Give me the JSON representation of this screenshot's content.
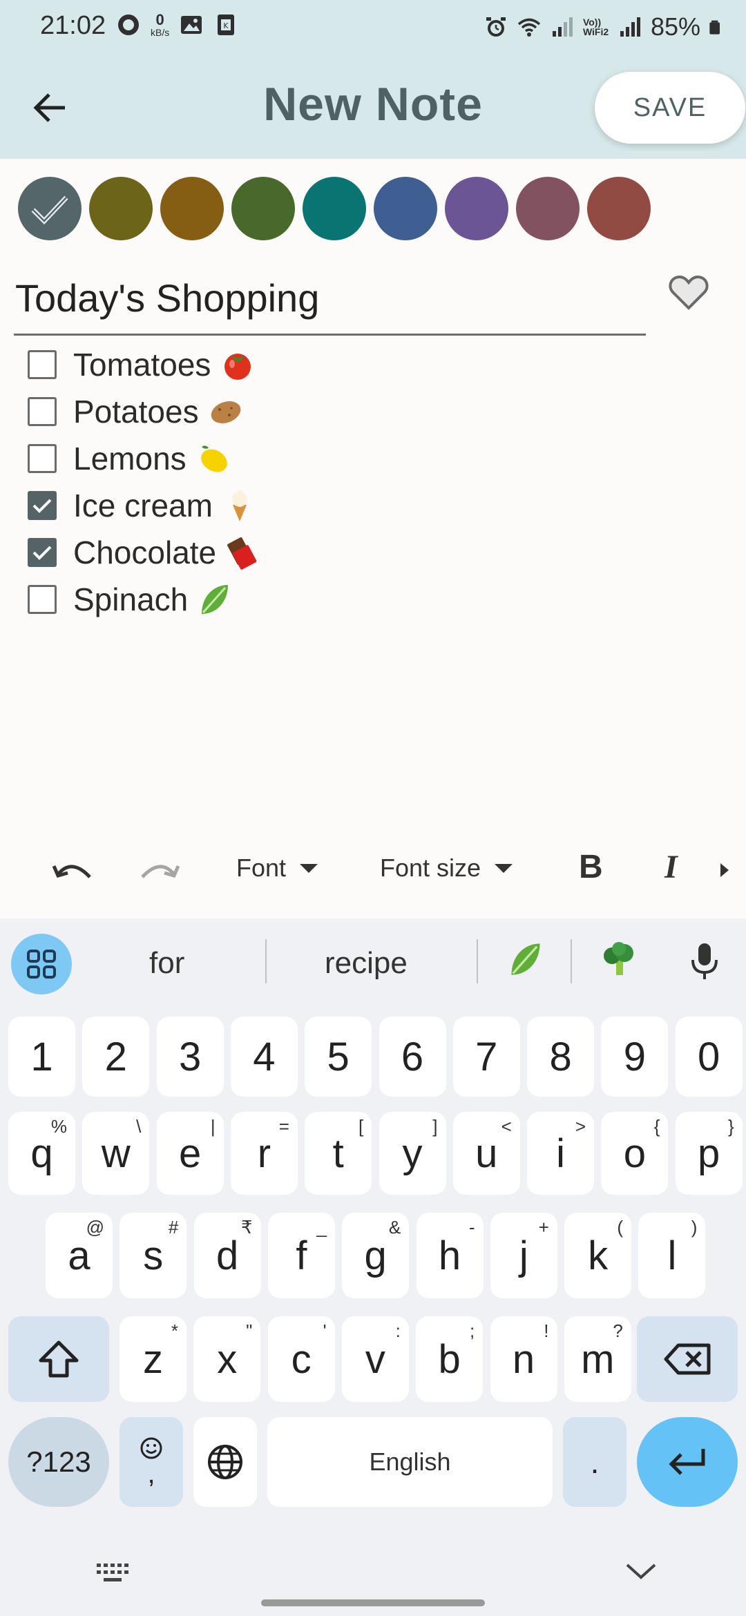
{
  "status_bar": {
    "time": "21:02",
    "net_speed": "0",
    "net_speed_unit": "kB/s",
    "battery": "85%",
    "wifi_label": "Vo)) WiFi2"
  },
  "app_bar": {
    "title": "New Note",
    "save_label": "SAVE"
  },
  "colors": {
    "header_bg": "#d7e8ea",
    "swatches": [
      "#55666a",
      "#6b6419",
      "#855e14",
      "#48682c",
      "#0a7472",
      "#3f5e92",
      "#6c5594",
      "#835260",
      "#914b43"
    ]
  },
  "note": {
    "title": "Today's Shopping",
    "favorite": false,
    "items": [
      {
        "label": "Tomatoes",
        "checked": false,
        "emoji": "tomato"
      },
      {
        "label": "Potatoes",
        "checked": false,
        "emoji": "potato"
      },
      {
        "label": "Lemons",
        "checked": false,
        "emoji": "lemon"
      },
      {
        "label": "Ice cream",
        "checked": true,
        "emoji": "ice-cream"
      },
      {
        "label": "Chocolate",
        "checked": true,
        "emoji": "chocolate"
      },
      {
        "label": "Spinach",
        "checked": false,
        "emoji": "leafy-green"
      }
    ]
  },
  "toolbar": {
    "font_label": "Font",
    "font_size_label": "Font size",
    "bold_label": "B",
    "italic_label": "I"
  },
  "keyboard": {
    "suggestions": [
      "for",
      "recipe"
    ],
    "number_row": [
      "1",
      "2",
      "3",
      "4",
      "5",
      "6",
      "7",
      "8",
      "9",
      "0"
    ],
    "row1": [
      {
        "k": "q",
        "s": "%"
      },
      {
        "k": "w",
        "s": "\\"
      },
      {
        "k": "e",
        "s": "|"
      },
      {
        "k": "r",
        "s": "="
      },
      {
        "k": "t",
        "s": "["
      },
      {
        "k": "y",
        "s": "]"
      },
      {
        "k": "u",
        "s": "<"
      },
      {
        "k": "i",
        "s": ">"
      },
      {
        "k": "o",
        "s": "{"
      },
      {
        "k": "p",
        "s": "}"
      }
    ],
    "row2": [
      {
        "k": "a",
        "s": "@"
      },
      {
        "k": "s",
        "s": "#"
      },
      {
        "k": "d",
        "s": "₹"
      },
      {
        "k": "f",
        "s": "_"
      },
      {
        "k": "g",
        "s": "&"
      },
      {
        "k": "h",
        "s": "-"
      },
      {
        "k": "j",
        "s": "+"
      },
      {
        "k": "k",
        "s": "("
      },
      {
        "k": "l",
        "s": ")"
      }
    ],
    "row3": [
      {
        "k": "z",
        "s": "*"
      },
      {
        "k": "x",
        "s": "\""
      },
      {
        "k": "c",
        "s": "'"
      },
      {
        "k": "v",
        "s": ":"
      },
      {
        "k": "b",
        "s": ";"
      },
      {
        "k": "n",
        "s": "!"
      },
      {
        "k": "m",
        "s": "?"
      }
    ],
    "symbols_label": "?123",
    "comma_label": ",",
    "space_label": "English",
    "period_label": "."
  }
}
